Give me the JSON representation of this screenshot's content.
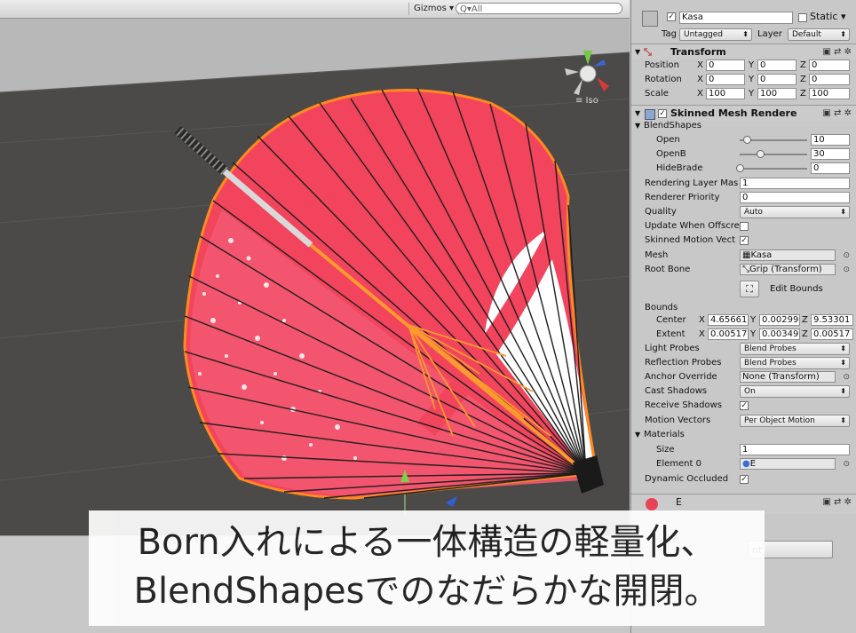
{
  "scene": {
    "gizmos_label": "Gizmos ▾",
    "search_placeholder": "Q▾All",
    "projection_label": "≡ Iso"
  },
  "inspector": {
    "object_name": "Kasa",
    "static_label": "Static ▾",
    "tag_label": "Tag",
    "tag_value": "Untagged",
    "layer_label": "Layer",
    "layer_value": "Default",
    "transform": {
      "title": "Transform",
      "rows": [
        {
          "label": "Position",
          "x": "0",
          "y": "0",
          "z": "0"
        },
        {
          "label": "Rotation",
          "x": "0",
          "y": "0",
          "z": "0"
        },
        {
          "label": "Scale",
          "x": "100",
          "y": "100",
          "z": "100"
        }
      ]
    },
    "smr": {
      "title": "Skinned Mesh Rendere",
      "blendshapes_label": "BlendShapes",
      "blendshapes": [
        {
          "label": "Open",
          "value": "10",
          "fraction": 0.1
        },
        {
          "label": "OpenB",
          "value": "30",
          "fraction": 0.3
        },
        {
          "label": "HideBrade",
          "value": "0",
          "fraction": 0.0
        }
      ],
      "rendering_layer_label": "Rendering Layer Mas",
      "rendering_layer_value": "1",
      "renderer_priority_label": "Renderer Priority",
      "renderer_priority_value": "0",
      "quality_label": "Quality",
      "quality_value": "Auto",
      "update_offscreen_label": "Update When Offscre",
      "skinned_motion_label": "Skinned Motion Vect",
      "mesh_label": "Mesh",
      "mesh_value": "Kasa",
      "root_bone_label": "Root Bone",
      "root_bone_value": "Grip (Transform)",
      "edit_bounds_label": "Edit Bounds",
      "bounds_label": "Bounds",
      "center_label": "Center",
      "center": {
        "x": "4.65661",
        "y": "0.00299",
        "z": "9.53301"
      },
      "extent_label": "Extent",
      "extent": {
        "x": "0.00517",
        "y": "0.00349",
        "z": "0.00517"
      },
      "light_probes_label": "Light Probes",
      "light_probes_value": "Blend Probes",
      "reflection_probes_label": "Reflection Probes",
      "reflection_probes_value": "Blend Probes",
      "anchor_override_label": "Anchor Override",
      "anchor_override_value": "None (Transform)",
      "cast_shadows_label": "Cast Shadows",
      "cast_shadows_value": "On",
      "receive_shadows_label": "Receive Shadows",
      "motion_vectors_label": "Motion Vectors",
      "motion_vectors_value": "Per Object Motion",
      "materials_label": "Materials",
      "size_label": "Size",
      "size_value": "1",
      "element0_label": "Element 0",
      "element0_value": "E",
      "dynamic_occluded_label": "Dynamic Occluded"
    },
    "material_name": "E",
    "hidden_button_text": "nt"
  },
  "caption": {
    "line1": "Born入れによる一体構造の軽量化、",
    "line2": "BlendShapesでのなだらかな開閉。"
  },
  "colors": {
    "umbrella_red": "#f0405a",
    "umbrella_white": "#ffffff",
    "selection_orange": "#ff8a1e",
    "ground": "#4b4a48",
    "sky": "#b7b7b7"
  }
}
